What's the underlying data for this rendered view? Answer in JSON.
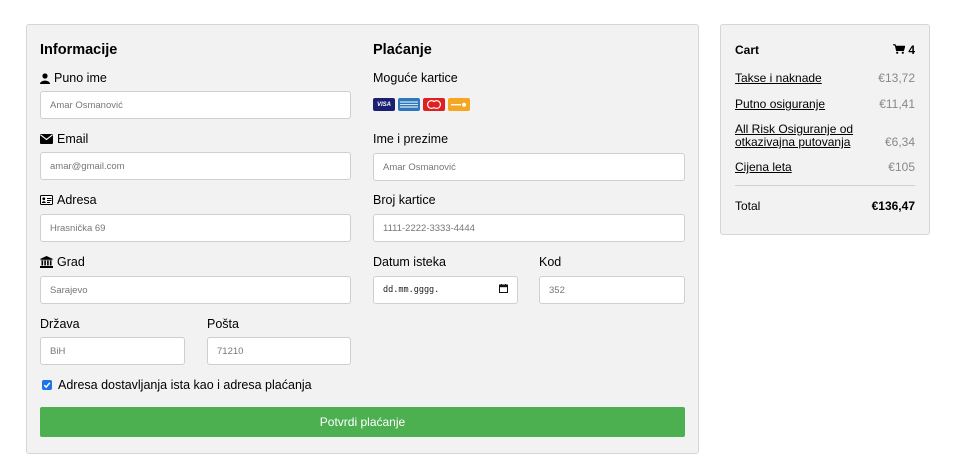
{
  "info": {
    "title": "Informacije",
    "name_label": "Puno ime",
    "name_value": "Amar Osmanović",
    "email_label": "Email",
    "email_value": "amar@gmail.com",
    "address_label": "Adresa",
    "address_value": "Hrasnička 69",
    "city_label": "Grad",
    "city_value": "Sarajevo",
    "state_label": "Država",
    "state_value": "BiH",
    "zip_label": "Pošta",
    "zip_value": "71210"
  },
  "payment": {
    "title": "Plaćanje",
    "cards_label": "Moguće kartice",
    "cards": [
      "VISA",
      "AMEX",
      "Mastercard",
      "DISCOVER"
    ],
    "cardholder_label": "Ime i prezime",
    "cardholder_value": "Amar Osmanović",
    "card_number_label": "Broj kartice",
    "card_number_value": "1111-2222-3333-4444",
    "expiry_label": "Datum isteka",
    "expiry_value": "dd.mm.gggg.",
    "cvv_label": "Kod",
    "cvv_value": "352"
  },
  "checkbox": {
    "label": "Adresa dostavljanja ista kao i adresa plaćanja",
    "checked": true
  },
  "submit_label": "Potvrdi plaćanje",
  "cart": {
    "title": "Cart",
    "count": "4",
    "items": [
      {
        "label": "Takse i naknade",
        "price": "€13,72"
      },
      {
        "label": "Putno osiguranje",
        "price": "€11,41"
      },
      {
        "label": "All Risk Osiguranje od otkazivajna putovanja",
        "price": "€6,34"
      },
      {
        "label": "Cijena leta",
        "price": "€105"
      }
    ],
    "total_label": "Total",
    "total_value": "€136,47"
  },
  "colors": {
    "submit_bg": "#4caf50",
    "panel_bg": "#f2f2f2",
    "checkbox": "#1a73e8"
  }
}
